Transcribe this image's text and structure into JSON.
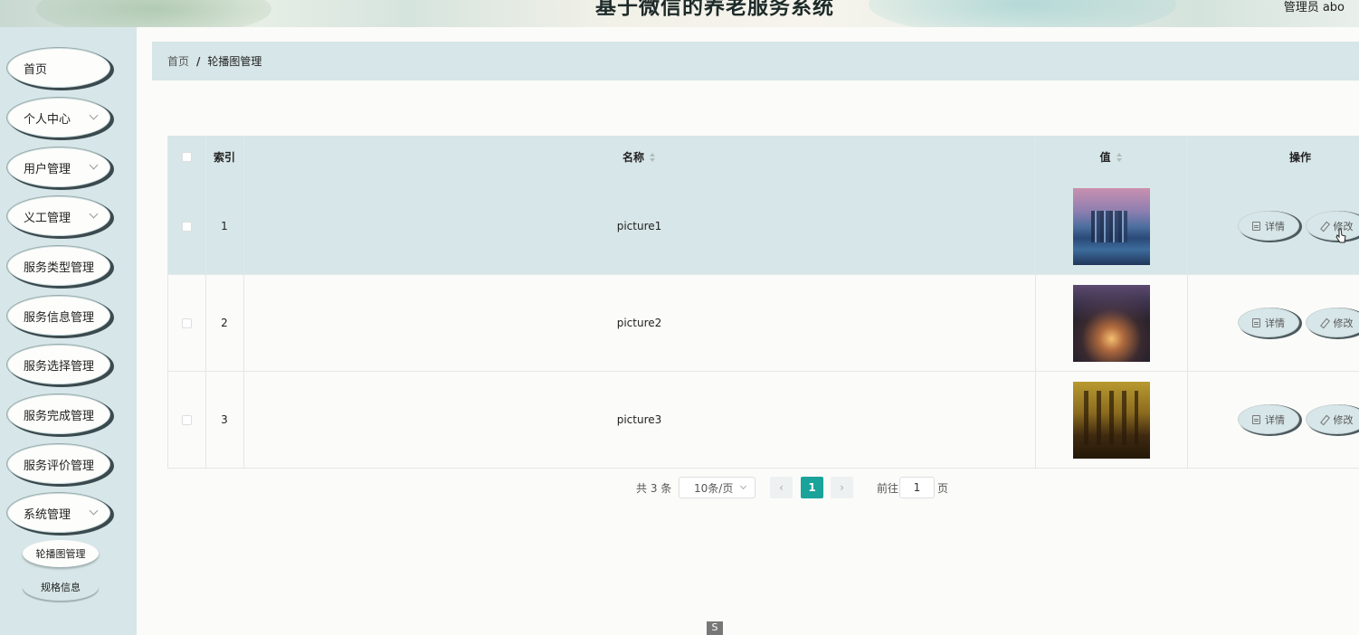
{
  "header": {
    "title": "基于微信的养老服务系统",
    "user": "管理员 abo"
  },
  "sidebar": {
    "items": [
      {
        "label": "首页",
        "has_children": false
      },
      {
        "label": "个人中心",
        "has_children": true
      },
      {
        "label": "用户管理",
        "has_children": true
      },
      {
        "label": "义工管理",
        "has_children": true
      },
      {
        "label": "服务类型管理",
        "has_children": false
      },
      {
        "label": "服务信息管理",
        "has_children": false
      },
      {
        "label": "服务选择管理",
        "has_children": false
      },
      {
        "label": "服务完成管理",
        "has_children": false
      },
      {
        "label": "服务评价管理",
        "has_children": false
      },
      {
        "label": "系统管理",
        "has_children": true
      }
    ],
    "sub_items": [
      {
        "label": "轮播图管理",
        "active": true
      },
      {
        "label": "规格信息",
        "active": false
      }
    ]
  },
  "breadcrumb": {
    "home": "首页",
    "separator": "/",
    "current": "轮播图管理"
  },
  "table": {
    "columns": {
      "index": "索引",
      "name": "名称",
      "value": "值",
      "action": "操作"
    },
    "rows": [
      {
        "index": "1",
        "name": "picture1",
        "image": "city-skyline-dusk",
        "highlighted": true
      },
      {
        "index": "2",
        "name": "picture2",
        "image": "city-night-tower",
        "highlighted": false
      },
      {
        "index": "3",
        "name": "picture3",
        "image": "city-golden-ruins",
        "highlighted": false
      }
    ],
    "actions": {
      "detail": "详情",
      "edit": "修改"
    }
  },
  "pagination": {
    "total_text": "共 3 条",
    "page_size": "10条/页",
    "current_page": "1",
    "goto_label": "前往",
    "goto_value": "1",
    "page_unit": "页"
  },
  "bottom_mark": "S",
  "colors": {
    "accent": "#1aa39a",
    "panel": "#d7e6e8"
  }
}
